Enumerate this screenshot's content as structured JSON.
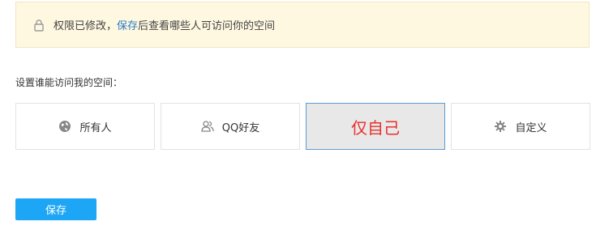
{
  "notice": {
    "text_before": "权限已修改，",
    "link": "保存",
    "text_after": "后查看哪些人可访问你的空间",
    "icon": "lock-icon"
  },
  "section_label": "设置谁能访问我的空间：",
  "options": [
    {
      "label": "所有人",
      "icon": "globe-icon",
      "selected": false
    },
    {
      "label": "QQ好友",
      "icon": "friends-icon",
      "selected": false
    },
    {
      "label": "仅自己",
      "icon": "",
      "selected": true
    },
    {
      "label": "自定义",
      "icon": "gear-icon",
      "selected": false
    }
  ],
  "save_button": "保存",
  "colors": {
    "notice_bg": "#fff8e1",
    "link": "#2b7bc4",
    "selected_text": "#e8302e",
    "selected_border": "#5b9bd1",
    "button_bg": "#1da6f6"
  }
}
